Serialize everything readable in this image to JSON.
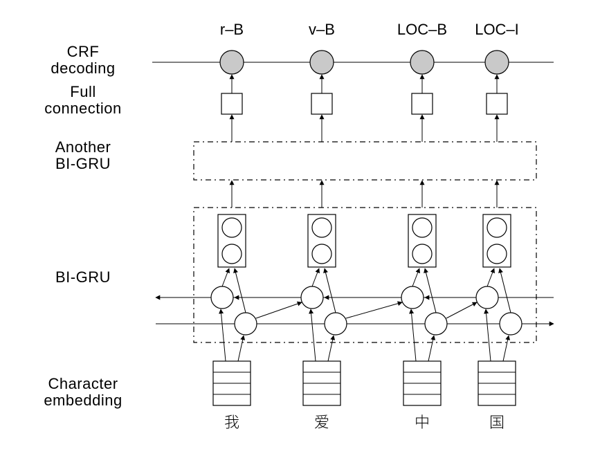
{
  "labels": {
    "crf": [
      "CRF",
      "decoding"
    ],
    "fc": [
      "Full",
      "connection"
    ],
    "bigru2": [
      "Another",
      "BI-GRU"
    ],
    "bigru": [
      "BI-GRU"
    ],
    "embed": [
      "Character",
      "embedding"
    ]
  },
  "columns": {
    "tags": [
      "r–B",
      "v–B",
      "LOC–B",
      "LOC–I"
    ],
    "chars": [
      "我",
      "爱",
      "中",
      "国"
    ]
  },
  "style": {
    "crf_fill": "#c9c9c9"
  }
}
